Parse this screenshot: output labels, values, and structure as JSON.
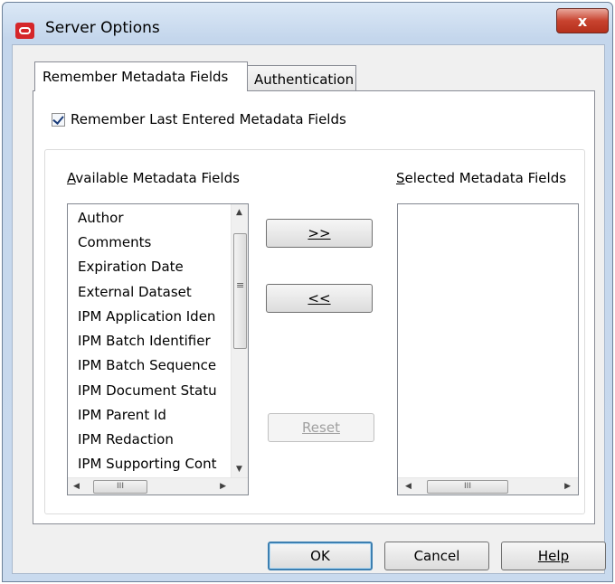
{
  "window": {
    "title": "Server Options",
    "close_label": "x"
  },
  "tabs": [
    {
      "label": "Remember Metadata Fields",
      "active": true
    },
    {
      "label": "Authentication",
      "active": false
    }
  ],
  "remember_checkbox": {
    "label": "Remember Last Entered Metadata Fields",
    "checked": true
  },
  "available": {
    "label": "Available Metadata Fields",
    "items": [
      "Author",
      "Comments",
      "Expiration Date",
      "External Dataset",
      "IPM Application Iden",
      "IPM Batch Identifier",
      "IPM Batch Sequence",
      "IPM Document Statu",
      "IPM Parent Id",
      "IPM Redaction",
      "IPM Supporting Cont"
    ]
  },
  "selected": {
    "label": "Selected Metadata Fields",
    "items": []
  },
  "buttons": {
    "add_label": ">>",
    "remove_label": "<<",
    "reset_label": "Reset",
    "ok_label": "OK",
    "cancel_label": "Cancel",
    "help_label": "Help"
  },
  "scroll_glyph": "III",
  "scroll_grip": "≡",
  "arrows": {
    "up": "▲",
    "down": "▼",
    "left": "◀",
    "right": "▶"
  }
}
